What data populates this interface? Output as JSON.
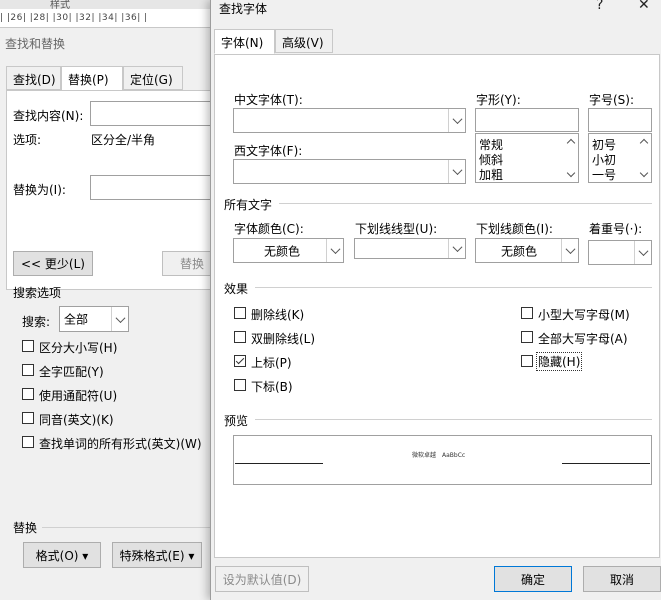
{
  "bg_dialog": {
    "title": "查找和替换",
    "ruler_top": "样式",
    "ruler_marks": "|  |26|  |28|  |30|  |32|  |34|  |36|  |",
    "tabs": [
      {
        "label": "查找(D)",
        "active": false
      },
      {
        "label": "替换(P)",
        "active": true
      },
      {
        "label": "定位(G)",
        "active": false
      }
    ],
    "find_label": "查找内容(N):",
    "options_label": "选项:",
    "options_value": "区分全/半角",
    "replace_label": "替换为(I):",
    "less_button": "<< 更少(L)",
    "replace_button": "替换",
    "search_options_title": "搜索选项",
    "search_label": "搜索:",
    "search_value": "全部",
    "checkboxes": [
      {
        "label": "区分大小写(H)",
        "checked": false
      },
      {
        "label": "全字匹配(Y)",
        "checked": false
      },
      {
        "label": "使用通配符(U)",
        "checked": false
      },
      {
        "label": "同音(英文)(K)",
        "checked": false
      },
      {
        "label": "查找单词的所有形式(英文)(W)",
        "checked": false
      }
    ],
    "replace_section_title": "替换",
    "format_button": "格式(O) ▾",
    "special_button": "特殊格式(E) ▾"
  },
  "font_dialog": {
    "title": "查找字体",
    "help_glyph": "?",
    "close_glyph": "✕",
    "tabs": [
      {
        "label": "字体(N)",
        "active": true
      },
      {
        "label": "高级(V)",
        "active": false
      }
    ],
    "chinese_font_label": "中文字体(T):",
    "chinese_font_value": "",
    "western_font_label": "西文字体(F):",
    "western_font_value": "",
    "style_label": "字形(Y):",
    "style_value": "",
    "style_options": [
      "常规",
      "倾斜",
      "加粗"
    ],
    "size_label": "字号(S):",
    "size_value": "",
    "size_options": [
      "初号",
      "小初",
      "一号"
    ],
    "all_text_title": "所有文字",
    "font_color_label": "字体颜色(C):",
    "font_color_value": "无颜色",
    "underline_style_label": "下划线线型(U):",
    "underline_style_value": "",
    "underline_color_label": "下划线颜色(I):",
    "underline_color_value": "无颜色",
    "emphasis_label": "着重号(·):",
    "emphasis_value": "",
    "effects_title": "效果",
    "effects_left": [
      {
        "label": "删除线(K)",
        "checked": false
      },
      {
        "label": "双删除线(L)",
        "checked": false
      },
      {
        "label": "上标(P)",
        "checked": true
      },
      {
        "label": "下标(B)",
        "checked": false
      }
    ],
    "effects_right": [
      {
        "label": "小型大写字母(M)",
        "checked": false
      },
      {
        "label": "全部大写字母(A)",
        "checked": false
      },
      {
        "label": "隐藏(H)",
        "checked": false
      }
    ],
    "preview_title": "预览",
    "preview_text": "微软卓越　AaBbCc",
    "default_button": "设为默认值(D)",
    "ok_button": "确定",
    "cancel_button": "取消"
  }
}
